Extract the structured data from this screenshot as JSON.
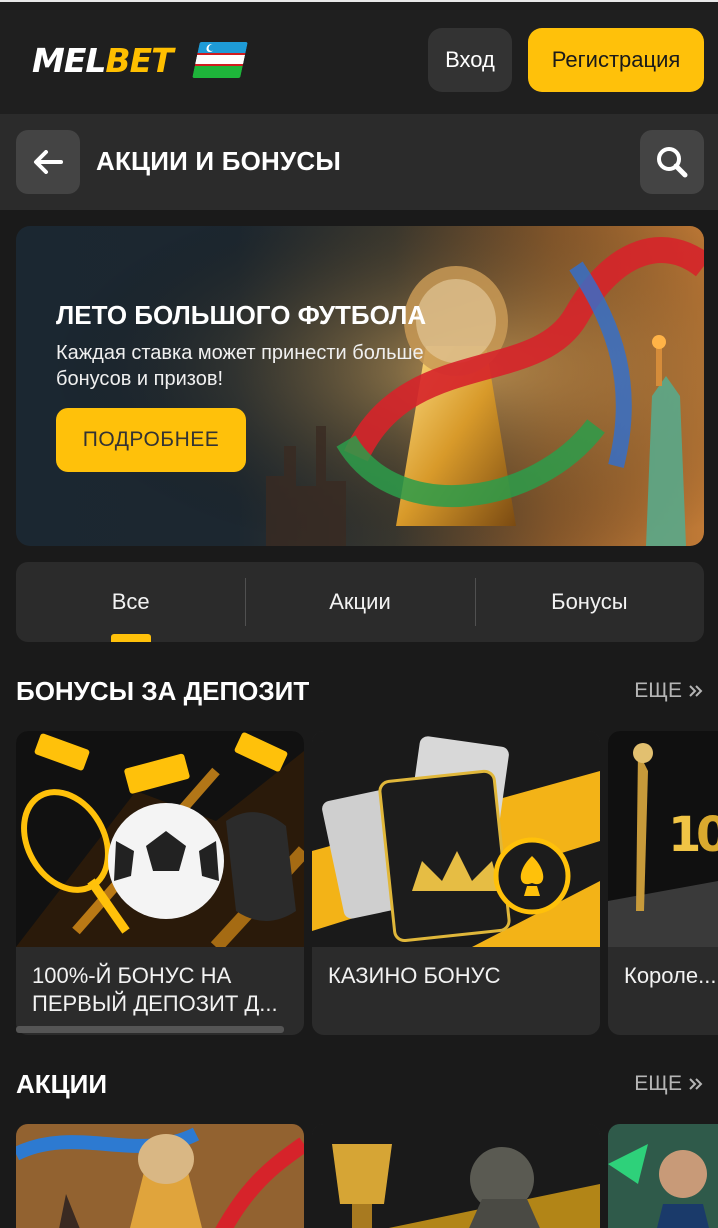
{
  "header": {
    "logo_part1": "MEL",
    "logo_part2": "BET",
    "login_label": "Вход",
    "register_label": "Регистрация",
    "flag_icon": "uzbekistan-flag-icon"
  },
  "titlebar": {
    "title": "АКЦИИ И БОНУСЫ",
    "back_icon": "arrow-left-icon",
    "search_icon": "search-icon"
  },
  "hero": {
    "title": "ЛЕТО БОЛЬШОГО ФУТБОЛА",
    "subtitle": "Каждая ставка может принести больше бонусов и призов!",
    "button_label": "ПОДРОБНЕЕ"
  },
  "tabs": [
    {
      "label": "Все",
      "active": true
    },
    {
      "label": "Акции",
      "active": false
    },
    {
      "label": "Бонусы",
      "active": false
    }
  ],
  "sections": {
    "deposit": {
      "title": "БОНУСЫ ЗА ДЕПОЗИТ",
      "more_label": "ЕЩЕ",
      "cards": [
        {
          "title": "100%-Й БОНУС НА ПЕРВЫЙ ДЕПОЗИТ Д..."
        },
        {
          "title": "КАЗИНО БОНУС"
        },
        {
          "title": "Короле... понеде..."
        }
      ]
    },
    "promos": {
      "title": "АКЦИИ",
      "more_label": "ЕЩЕ"
    }
  },
  "colors": {
    "accent": "#ffc10a",
    "background": "#1a1a1a",
    "panel": "#2b2b2b"
  }
}
